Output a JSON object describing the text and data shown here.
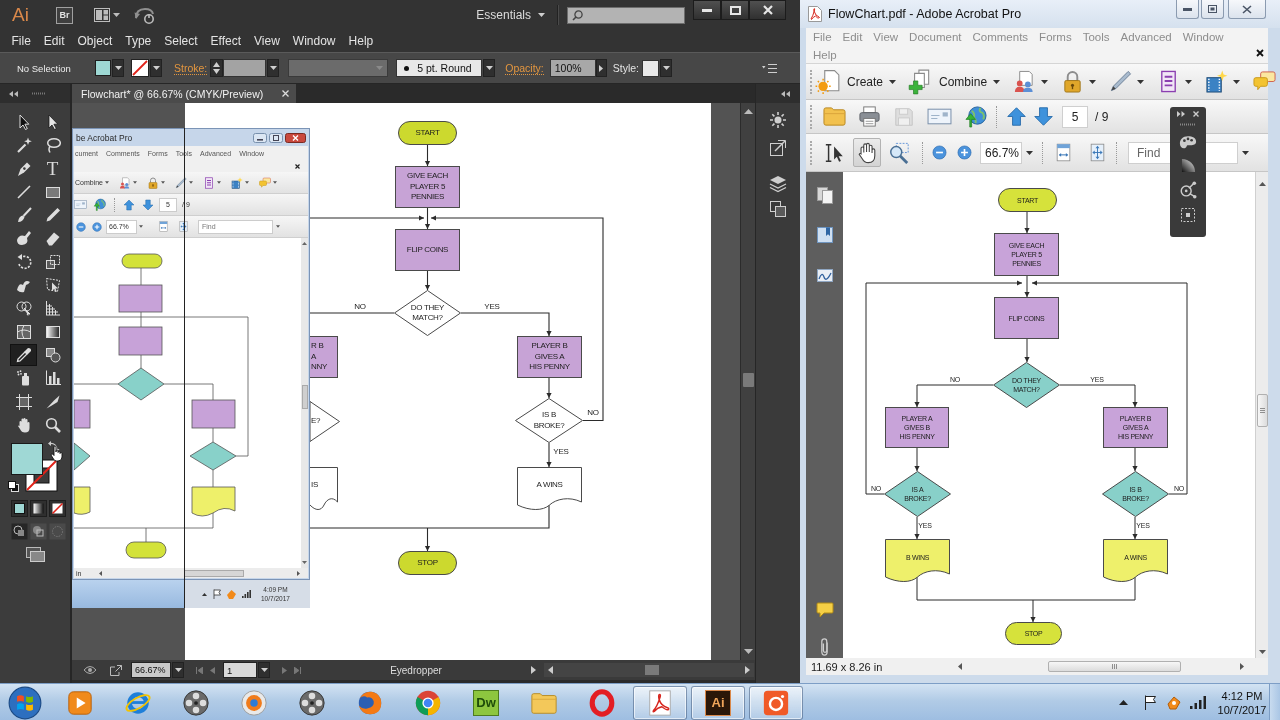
{
  "illustrator": {
    "app_bar": {
      "logo": "Ai",
      "bridge": "Br",
      "workspace": "Essentials"
    },
    "menu": [
      "File",
      "Edit",
      "Object",
      "Type",
      "Select",
      "Effect",
      "View",
      "Window",
      "Help"
    ],
    "control_bar": {
      "selection": "No Selection",
      "stroke_label": "Stroke:",
      "brush": "5 pt. Round",
      "opacity_label": "Opacity:",
      "opacity": "100%",
      "style_label": "Style:"
    },
    "tools": [
      {
        "selected": false
      },
      {
        "selected": false
      },
      {
        "selected": false
      },
      {
        "selected": false
      },
      {
        "selected": false
      },
      {
        "selected": false,
        "glyph": "T"
      },
      {
        "selected": false
      },
      {
        "selected": false
      },
      {
        "selected": false
      },
      {
        "selected": false
      },
      {
        "selected": false
      },
      {
        "selected": false
      },
      {
        "selected": false
      },
      {
        "selected": false
      },
      {
        "selected": false
      },
      {
        "selected": false
      },
      {
        "selected": false
      },
      {
        "selected": false
      },
      {
        "selected": false
      },
      {
        "selected": false
      },
      {
        "selected": true
      },
      {
        "selected": false
      },
      {
        "selected": false
      },
      {
        "selected": false
      },
      {
        "selected": false
      },
      {
        "selected": false
      },
      {
        "selected": false
      },
      {
        "selected": false
      }
    ],
    "document_tab": "Flowchart* @ 66.67% (CMYK/Preview)",
    "placed_screenshot": {
      "title": "be Acrobat Pro",
      "menu": [
        "cument",
        "Comments",
        "Forms",
        "Tools",
        "Advanced",
        "Window"
      ],
      "combine": "Combine",
      "page": "5",
      "page_count": "/ 9",
      "zoom": "66.7%",
      "find": {
        "placeholder": "Find"
      },
      "page_size": "in",
      "time": "4:09 PM",
      "date": "10/7/2017"
    },
    "flowchart": {
      "nodes": [
        {
          "kind": "terminal",
          "label": "START",
          "color": "#ccd92e"
        },
        {
          "kind": "process",
          "label": "GIVE EACH\nPLAYER 5\nPENNIES",
          "color": "#c7a3d6"
        },
        {
          "kind": "process",
          "label": "FLIP COINS",
          "color": "#c7a3d6"
        },
        {
          "kind": "decision",
          "label": "DO THEY\nMATCH?"
        },
        {
          "kind": "process",
          "label": "R B\nA\nNNY",
          "color": "#c7a3d6"
        },
        {
          "kind": "process",
          "label": "PLAYER B\nGIVES A\nHIS PENNY",
          "color": "#c7a3d6"
        },
        {
          "kind": "decision",
          "label": "E?"
        },
        {
          "kind": "decision",
          "label": "IS B\nBROKE?"
        },
        {
          "kind": "document",
          "label": "IS"
        },
        {
          "kind": "document",
          "label": "A WINS"
        },
        {
          "kind": "terminal",
          "label": "STOP",
          "color": "#ccd92e"
        }
      ],
      "edge_labels": [
        "NO",
        "YES",
        "NO",
        "YES"
      ]
    },
    "status_bar": {
      "zoom": "66.67%",
      "artboard": "1",
      "tool": "Eyedropper"
    }
  },
  "acrobat": {
    "title": "FlowChart.pdf - Adobe Acrobat Pro",
    "menu": [
      "File",
      "Edit",
      "View",
      "Document",
      "Comments",
      "Forms",
      "Tools",
      "Advanced",
      "Window",
      "Help"
    ],
    "toolbar": {
      "create": "Create",
      "combine": "Combine"
    },
    "page": "5",
    "page_count": "/ 9",
    "tools": [
      {
        "selected": false
      },
      {
        "selected": true
      },
      {
        "selected": false
      }
    ],
    "zoom": "66.7%",
    "find": {
      "placeholder": "Find"
    },
    "flowchart": {
      "nodes": [
        {
          "kind": "terminal",
          "label": "START",
          "color": "#d6e23b"
        },
        {
          "kind": "process",
          "label": "GIVE EACH\nPLAYER 5\nPENNIES",
          "color": "#c8a3d9"
        },
        {
          "kind": "process",
          "label": "FLIP COINS",
          "color": "#c8a3d9"
        },
        {
          "kind": "decision",
          "label": "DO THEY\nMATCH?",
          "color": "#88d0c9"
        },
        {
          "kind": "process",
          "label": "PLAYER A\nGIVES B\nHIS PENNY",
          "color": "#c8a3d9"
        },
        {
          "kind": "process",
          "label": "PLAYER B\nGIVES A\nHIS PENNY",
          "color": "#c8a3d9"
        },
        {
          "kind": "decision",
          "label": "IS A\nBROKE?",
          "color": "#88d0c9"
        },
        {
          "kind": "decision",
          "label": "IS B\nBROKE?",
          "color": "#88d0c9"
        },
        {
          "kind": "document",
          "label": "B WINS",
          "color": "#eef06b"
        },
        {
          "kind": "document",
          "label": "A WINS",
          "color": "#eef06b"
        },
        {
          "kind": "terminal",
          "label": "STOP",
          "color": "#d6e23b"
        }
      ],
      "edge_labels": [
        "NO",
        "YES",
        "NO",
        "NO",
        "YES",
        "YES"
      ]
    },
    "page_size": "11.69 x 8.26 in"
  },
  "taskbar": {
    "apps": [
      {
        "running": false
      },
      {
        "running": false
      },
      {
        "running": false
      },
      {
        "running": false
      },
      {
        "running": false
      },
      {
        "running": false
      },
      {
        "running": false
      },
      {
        "running": false,
        "glyph": "Dw"
      },
      {
        "running": false
      },
      {
        "running": false
      },
      {
        "running": true
      },
      {
        "running": true,
        "glyph": "Ai"
      },
      {
        "running": true
      }
    ],
    "time": "4:12 PM",
    "date": "10/7/2017"
  }
}
